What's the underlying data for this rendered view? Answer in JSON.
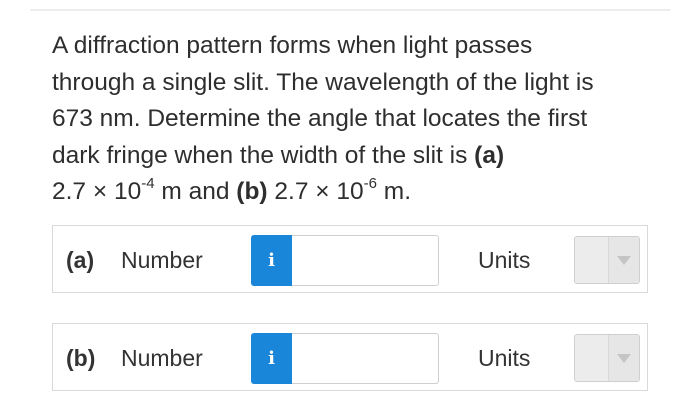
{
  "question": {
    "line1": "A diffraction pattern forms when light passes",
    "line2": "through a single slit. The wavelength of the light is",
    "line3": "673 nm. Determine the angle that locates the first",
    "line4_text": "dark fringe when the width of the slit is ",
    "line4_part": "(a)",
    "line5_a_mantissa": "2.7 × 10",
    "line5_a_exp": "-4",
    "line5_a_unit": " m and ",
    "line5_b_part": "(b)",
    "line5_b_mantissa": " 2.7 × 10",
    "line5_b_exp": "-6",
    "line5_b_unit": " m."
  },
  "rows": [
    {
      "part": "(a)",
      "number_label": "Number",
      "info_label": "i",
      "input_value": "",
      "units_label": "Units",
      "units_selected": ""
    },
    {
      "part": "(b)",
      "number_label": "Number",
      "info_label": "i",
      "input_value": "",
      "units_label": "Units",
      "units_selected": ""
    }
  ],
  "colors": {
    "info_button": "#1a86d9",
    "text": "#2e2e2e",
    "border": "#d9d9d9"
  },
  "icons": {
    "info": "info-icon",
    "dropdown": "chevron-down-icon"
  }
}
